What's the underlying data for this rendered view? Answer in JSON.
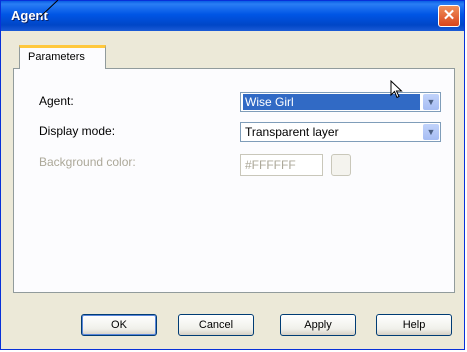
{
  "window": {
    "title": "Agent"
  },
  "tabs": [
    {
      "label": "Parameters"
    }
  ],
  "form": {
    "agent_label": "Agent:",
    "agent_value": "Wise Girl",
    "display_mode_label": "Display mode:",
    "display_mode_value": "Transparent layer",
    "background_color_label": "Background color:",
    "background_color_value": "#FFFFFF"
  },
  "buttons": {
    "ok": "OK",
    "cancel": "Cancel",
    "apply": "Apply",
    "help": "Help"
  },
  "icons": {
    "close": "close-icon",
    "dropdown": "chevron-down-icon",
    "cursor": "mouse-pointer-icon"
  },
  "colors": {
    "titlebar": "#0055e5",
    "selection": "#316ac5",
    "close_button": "#d9441c",
    "tab_accent": "#ffc83c"
  }
}
